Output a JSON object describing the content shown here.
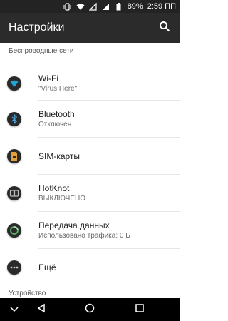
{
  "status_bar": {
    "battery_percent": "89%",
    "time": "2:59 ПП",
    "icons": [
      "vibrate-icon",
      "wifi-icon",
      "data-off-icon",
      "signal-icon",
      "battery-icon"
    ]
  },
  "app_bar": {
    "title": "Настройки",
    "search_icon": "search-icon"
  },
  "sections": [
    {
      "header": "Беспроводные сети",
      "items": [
        {
          "title": "Wi-Fi",
          "subtitle": "\"Virus Here\"",
          "icon": "wifi-icon",
          "accent": "#1ea4d8"
        },
        {
          "title": "Bluetooth",
          "subtitle": "Отключен",
          "icon": "bluetooth-icon",
          "accent": "#4aa3df"
        },
        {
          "title": "SIM-карты",
          "subtitle": "",
          "icon": "sim-card-icon",
          "accent": "#e0a13a"
        },
        {
          "title": "HotKnot",
          "subtitle": "ВЫКЛЮЧЕНО",
          "icon": "hotknot-icon",
          "accent": "#bbbbbb"
        },
        {
          "title": "Передача данных",
          "subtitle": "Использовано трафика: 0 Б",
          "icon": "data-usage-icon",
          "accent": "#58b86a"
        },
        {
          "title": "Ещё",
          "subtitle": "",
          "icon": "more-icon",
          "accent": "#cccccc"
        }
      ]
    },
    {
      "header": "Устройство"
    }
  ],
  "nav_bar": {
    "buttons": [
      "chevron-down-icon",
      "back-icon",
      "home-icon",
      "recents-icon"
    ]
  }
}
